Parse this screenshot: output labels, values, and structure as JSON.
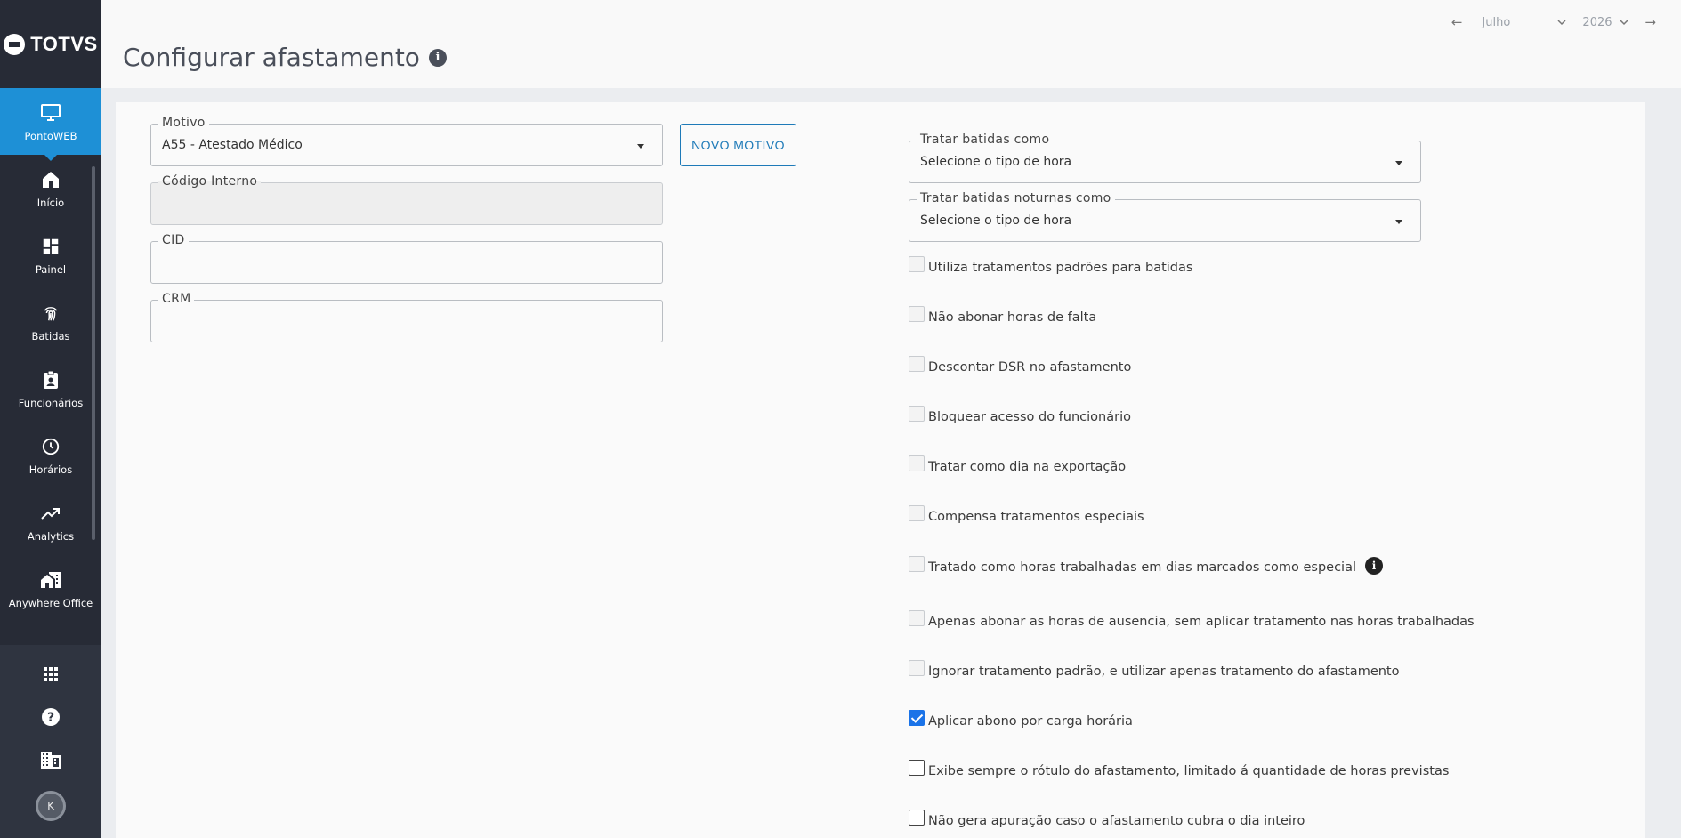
{
  "brand": {
    "name": "TOTVS"
  },
  "sidebar": {
    "active": {
      "label": "PontoWEB",
      "icon": "monitor-icon"
    },
    "items": [
      {
        "label": "Início",
        "icon": "home-icon"
      },
      {
        "label": "Painel",
        "icon": "dashboard-icon"
      },
      {
        "label": "Batidas",
        "icon": "fingerprint-icon"
      },
      {
        "label": "Funcionários",
        "icon": "badge-icon"
      },
      {
        "label": "Horários",
        "icon": "clock-icon"
      },
      {
        "label": "Analytics",
        "icon": "trending-up-icon"
      },
      {
        "label": "Anywhere Office",
        "icon": "home-work-icon"
      }
    ],
    "bottom": [
      {
        "icon": "apps-grid-icon"
      },
      {
        "icon": "help-icon"
      },
      {
        "icon": "building-icon"
      }
    ],
    "avatar_initial": "K"
  },
  "header": {
    "title": "Configurar afastamento",
    "month": "Julho",
    "year": "2026"
  },
  "form": {
    "motivo": {
      "label": "Motivo",
      "value": "A55 - Atestado Médico"
    },
    "novo_motivo_label": "NOVO MOTIVO",
    "codigo_interno": {
      "label": "Código Interno",
      "value": ""
    },
    "cid": {
      "label": "CID",
      "value": ""
    },
    "crm": {
      "label": "CRM",
      "value": ""
    },
    "tratar_batidas": {
      "label": "Tratar batidas como",
      "value": "Selecione o tipo de hora"
    },
    "tratar_noturnas": {
      "label": "Tratar batidas noturnas como",
      "value": "Selecione o tipo de hora"
    }
  },
  "options": [
    {
      "label": "Utiliza tratamentos padrões para batidas",
      "checked": false,
      "enabled": false
    },
    {
      "label": "Não abonar horas de falta",
      "checked": false,
      "enabled": false
    },
    {
      "label": "Descontar DSR no afastamento",
      "checked": false,
      "enabled": false
    },
    {
      "label": "Bloquear acesso do funcionário",
      "checked": false,
      "enabled": false
    },
    {
      "label": "Tratar como dia na exportação",
      "checked": false,
      "enabled": false
    },
    {
      "label": "Compensa tratamentos especiais",
      "checked": false,
      "enabled": false
    },
    {
      "label": "Tratado como horas trabalhadas em dias marcados como especial",
      "checked": false,
      "enabled": false,
      "info": true
    },
    {
      "label": "Apenas abonar as horas de ausencia, sem aplicar tratamento nas horas trabalhadas",
      "checked": false,
      "enabled": false
    },
    {
      "label": "Ignorar tratamento padrão, e utilizar apenas tratamento do afastamento",
      "checked": false,
      "enabled": false
    },
    {
      "label": "Aplicar abono por carga horária",
      "checked": true,
      "enabled": true
    },
    {
      "label": "Exibe sempre o rótulo do afastamento, limitado á quantidade de horas previstas",
      "checked": false,
      "enabled": true
    },
    {
      "label": "Não gera apuração caso o afastamento cubra o dia inteiro",
      "checked": false,
      "enabled": true
    }
  ],
  "colors": {
    "sidebar": "#272b36",
    "accent": "#1e90d6",
    "primary": "#1e7ab8",
    "checkbox": "#1a73e8"
  }
}
